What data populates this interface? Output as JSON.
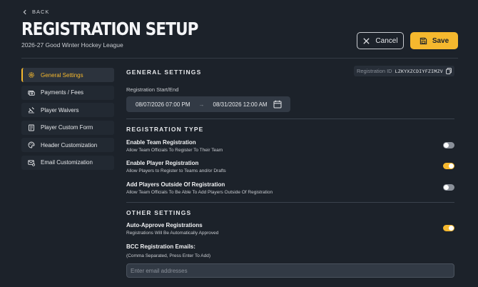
{
  "header": {
    "back_label": "BACK",
    "title": "REGISTRATION SETUP",
    "subtitle": "2026-27 Good Winter Hockey League",
    "cancel_label": "Cancel",
    "save_label": "Save"
  },
  "colors": {
    "accent": "#f5b82e",
    "background": "#1c222a",
    "panel": "#222932"
  },
  "sidebar": {
    "items": [
      {
        "label": "General Settings",
        "icon": "gear-icon",
        "active": true
      },
      {
        "label": "Payments / Fees",
        "icon": "money-icon",
        "active": false
      },
      {
        "label": "Player Waivers",
        "icon": "signature-icon",
        "active": false
      },
      {
        "label": "Player Custom Form",
        "icon": "form-icon",
        "active": false
      },
      {
        "label": "Header Customization",
        "icon": "palette-icon",
        "active": false
      },
      {
        "label": "Email Customization",
        "icon": "email-gear-icon",
        "active": false
      }
    ]
  },
  "general": {
    "title": "GENERAL SETTINGS",
    "registration_id_label": "Registration ID",
    "registration_id": "LZKYXZCDIYFZIMZV",
    "date_label": "Registration Start/End",
    "start": "08/07/2026 07:00 PM",
    "arrow": "→",
    "end": "08/31/2026 12:00 AM"
  },
  "registration_type": {
    "title": "REGISTRATION TYPE",
    "rows": [
      {
        "title": "Enable Team Registration",
        "desc": "Allow Team Officials To Register To Their Team",
        "enabled": false
      },
      {
        "title": "Enable Player Registration",
        "desc": "Allow Players to Register to Teams and/or Drafts",
        "enabled": true
      },
      {
        "title": "Add Players Outside Of Registration",
        "desc": "Allow Team Officials To Be Able To Add Players Outside Of Registration",
        "enabled": false
      }
    ]
  },
  "other": {
    "title": "OTHER SETTINGS",
    "auto_title": "Auto-Approve Registrations",
    "auto_desc": "Registrations Will Be Automatically Approved",
    "auto_enabled": true,
    "bcc_title": "BCC Registration Emails:",
    "bcc_desc": "(Comma Separated, Press Enter To Add)",
    "bcc_placeholder": "Enter email addresses",
    "bcc_value": ""
  }
}
